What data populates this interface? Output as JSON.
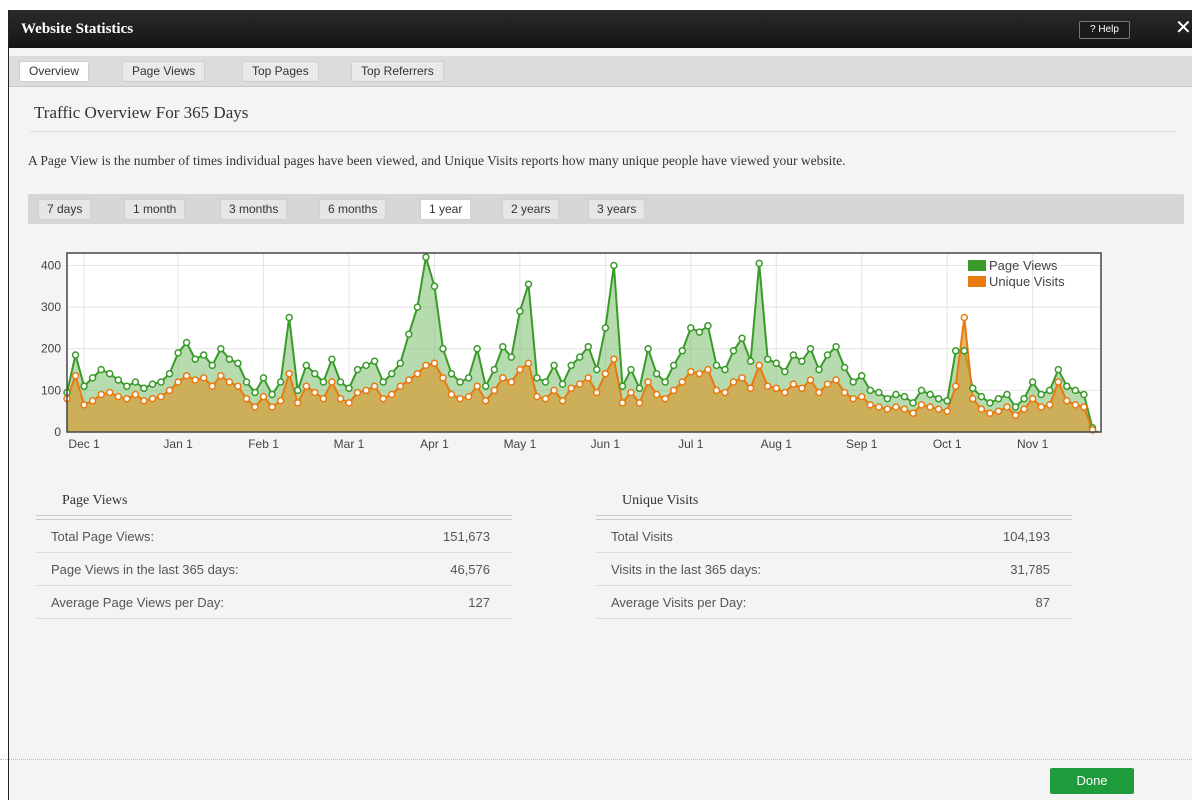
{
  "window": {
    "title": "Website Statistics",
    "help_label": "? Help",
    "close_glyph": "✕"
  },
  "tabs": [
    {
      "label": "Overview",
      "active": true
    },
    {
      "label": "Page Views",
      "active": false
    },
    {
      "label": "Top Pages",
      "active": false
    },
    {
      "label": "Top Referrers",
      "active": false
    }
  ],
  "overview": {
    "title": "Traffic Overview For 365 Days",
    "description": "A Page View is the number of times individual pages have been viewed, and Unique Visits reports how many unique people have viewed your website."
  },
  "ranges": [
    {
      "label": "7 days",
      "active": false
    },
    {
      "label": "1 month",
      "active": false
    },
    {
      "label": "3 months",
      "active": false
    },
    {
      "label": "6 months",
      "active": false
    },
    {
      "label": "1 year",
      "active": true
    },
    {
      "label": "2 years",
      "active": false
    },
    {
      "label": "3 years",
      "active": false
    }
  ],
  "chart_data": {
    "type": "area",
    "x": [
      "Nov 25",
      "Nov 28",
      "Dec 1",
      "Dec 4",
      "Dec 7",
      "Dec 10",
      "Dec 13",
      "Dec 16",
      "Dec 19",
      "Dec 22",
      "Dec 25",
      "Dec 28",
      "Dec 31",
      "Jan 3",
      "Jan 6",
      "Jan 9",
      "Jan 12",
      "Jan 15",
      "Jan 18",
      "Jan 21",
      "Jan 24",
      "Jan 27",
      "Jan 30",
      "Feb 2",
      "Feb 5",
      "Feb 8",
      "Feb 11",
      "Feb 14",
      "Feb 17",
      "Feb 20",
      "Feb 23",
      "Feb 26",
      "Mar 1",
      "Mar 4",
      "Mar 7",
      "Mar 10",
      "Mar 13",
      "Mar 16",
      "Mar 19",
      "Mar 22",
      "Mar 25",
      "Mar 28",
      "Mar 31",
      "Apr 3",
      "Apr 6",
      "Apr 9",
      "Apr 12",
      "Apr 15",
      "Apr 18",
      "Apr 21",
      "Apr 24",
      "Apr 27",
      "Apr 30",
      "May 3",
      "May 6",
      "May 9",
      "May 12",
      "May 15",
      "May 18",
      "May 21",
      "May 24",
      "May 27",
      "May 30",
      "Jun 2",
      "Jun 5",
      "Jun 8",
      "Jun 11",
      "Jun 14",
      "Jun 17",
      "Jun 20",
      "Jun 23",
      "Jun 26",
      "Jun 29",
      "Jul 2",
      "Jul 5",
      "Jul 8",
      "Jul 11",
      "Jul 14",
      "Jul 17",
      "Jul 20",
      "Jul 23",
      "Jul 26",
      "Jul 29",
      "Aug 1",
      "Aug 4",
      "Aug 7",
      "Aug 10",
      "Aug 13",
      "Aug 16",
      "Aug 19",
      "Aug 22",
      "Aug 25",
      "Aug 28",
      "Aug 31",
      "Sep 3",
      "Sep 6",
      "Sep 9",
      "Sep 12",
      "Sep 15",
      "Sep 18",
      "Sep 21",
      "Sep 24",
      "Sep 27",
      "Sep 30",
      "Oct 3",
      "Oct 6",
      "Oct 9",
      "Oct 12",
      "Oct 15",
      "Oct 18",
      "Oct 21",
      "Oct 24",
      "Oct 27",
      "Oct 30",
      "Nov 2",
      "Nov 5",
      "Nov 8",
      "Nov 11",
      "Nov 14",
      "Nov 17",
      "Nov 20",
      "Nov 23"
    ],
    "series": [
      {
        "name": "Page Views",
        "color": "#3a9a2a",
        "values": [
          95,
          185,
          110,
          130,
          150,
          140,
          125,
          110,
          120,
          105,
          115,
          120,
          140,
          190,
          215,
          175,
          185,
          160,
          200,
          175,
          165,
          120,
          95,
          130,
          90,
          120,
          275,
          100,
          160,
          140,
          120,
          175,
          120,
          105,
          150,
          160,
          170,
          120,
          140,
          165,
          235,
          300,
          420,
          350,
          200,
          140,
          120,
          130,
          200,
          110,
          150,
          205,
          180,
          290,
          355,
          130,
          120,
          160,
          115,
          160,
          180,
          205,
          150,
          250,
          400,
          110,
          150,
          105,
          200,
          140,
          120,
          160,
          195,
          250,
          240,
          255,
          160,
          150,
          195,
          225,
          170,
          405,
          175,
          165,
          145,
          185,
          170,
          200,
          150,
          185,
          205,
          155,
          120,
          135,
          100,
          95,
          80,
          90,
          85,
          70,
          100,
          90,
          80,
          75,
          195,
          195,
          105,
          85,
          70,
          80,
          90,
          60,
          80,
          120,
          90,
          100,
          150,
          110,
          100,
          90,
          10
        ]
      },
      {
        "name": "Unique Visits",
        "color": "#e87a10",
        "values": [
          80,
          135,
          65,
          75,
          90,
          95,
          85,
          80,
          90,
          75,
          80,
          85,
          100,
          120,
          135,
          125,
          130,
          110,
          135,
          120,
          110,
          80,
          60,
          85,
          60,
          75,
          140,
          70,
          110,
          95,
          80,
          120,
          80,
          70,
          95,
          100,
          110,
          80,
          90,
          110,
          125,
          140,
          160,
          165,
          130,
          90,
          80,
          85,
          110,
          75,
          100,
          130,
          120,
          150,
          165,
          85,
          80,
          100,
          75,
          105,
          115,
          130,
          95,
          140,
          175,
          70,
          95,
          70,
          120,
          90,
          80,
          100,
          120,
          145,
          140,
          150,
          100,
          95,
          120,
          130,
          105,
          160,
          110,
          105,
          95,
          115,
          105,
          125,
          95,
          115,
          125,
          95,
          80,
          85,
          65,
          60,
          55,
          60,
          55,
          45,
          65,
          60,
          55,
          50,
          110,
          275,
          80,
          55,
          45,
          50,
          60,
          40,
          55,
          80,
          60,
          65,
          120,
          75,
          65,
          60,
          5
        ]
      }
    ],
    "title": "",
    "xlabel": "",
    "ylabel": "",
    "ylim": [
      0,
      430
    ],
    "yticks": [
      0,
      100,
      200,
      300,
      400
    ],
    "xtick_labels": [
      "Dec 1",
      "Jan 1",
      "Feb 1",
      "Mar 1",
      "Apr 1",
      "May 1",
      "Jun 1",
      "Jul 1",
      "Aug 1",
      "Sep 1",
      "Oct 1",
      "Nov 1"
    ],
    "xtick_index": [
      2,
      13,
      23,
      33,
      43,
      53,
      63,
      73,
      83,
      93,
      103,
      113
    ],
    "grid": true,
    "legend_position": "top-right"
  },
  "stats": {
    "page_views": {
      "heading": "Page Views",
      "rows": [
        {
          "label": "Total Page Views:",
          "value": "151,673"
        },
        {
          "label": "Page Views in the last 365 days:",
          "value": "46,576"
        },
        {
          "label": "Average Page Views per Day:",
          "value": "127"
        }
      ]
    },
    "unique_visits": {
      "heading": "Unique Visits",
      "rows": [
        {
          "label": "Total Visits",
          "value": "104,193"
        },
        {
          "label": "Visits in the last 365 days:",
          "value": "31,785"
        },
        {
          "label": "Average Visits per Day:",
          "value": "87"
        }
      ]
    }
  },
  "footer": {
    "done_label": "Done"
  }
}
